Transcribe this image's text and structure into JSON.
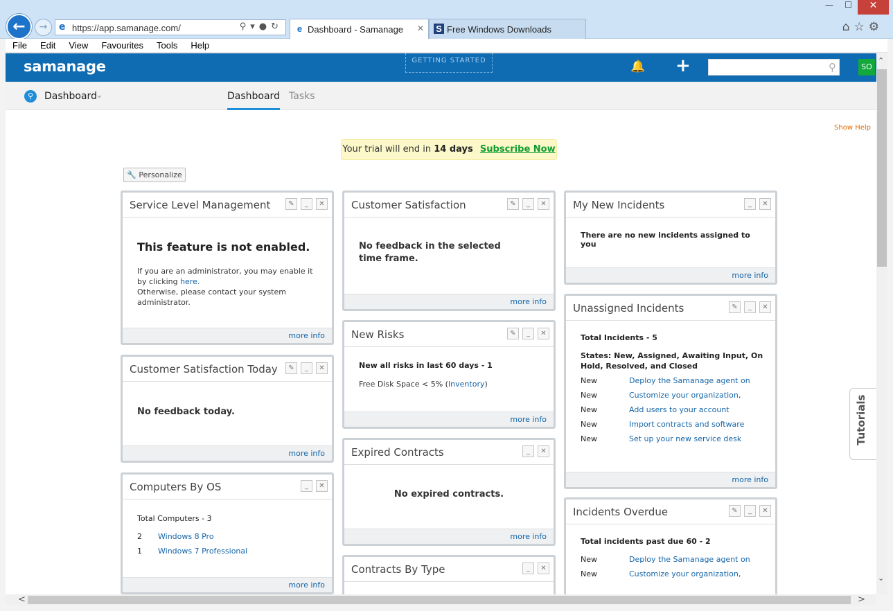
{
  "browser": {
    "url": "https://app.samanage.com/",
    "tabs": [
      {
        "label": "Dashboard - Samanage",
        "close": "✕"
      },
      {
        "label": "Free Windows Downloads"
      }
    ],
    "menu": [
      "File",
      "Edit",
      "View",
      "Favourites",
      "Tools",
      "Help"
    ],
    "window_controls": {
      "min": "—",
      "max": "☐",
      "close": "✕"
    }
  },
  "app": {
    "logo": "samanage",
    "getting_started": "GETTING STARTED",
    "avatar": "SO",
    "search_placeholder": "",
    "dashboard_title": "Dashboard",
    "subtabs": [
      "Dashboard",
      "Tasks"
    ],
    "show_help": "Show Help",
    "trial": {
      "prefix": "Your trial will end in",
      "days": "14 days",
      "cta": "Subscribe Now"
    },
    "personalize": "Personalize",
    "tutorials": "Tutorials"
  },
  "widgets": {
    "slm": {
      "title": "Service Level Management",
      "heading": "This feature is not enabled.",
      "line1": "If you are an administrator, you may enable it by clicking",
      "here": "here.",
      "line2": "Otherwise, please contact your system administrator.",
      "more": "more info"
    },
    "cst": {
      "title": "Customer Satisfaction Today",
      "text": "No feedback today.",
      "more": "more info"
    },
    "cbo": {
      "title": "Computers By OS",
      "total": "Total Computers - 3",
      "rows": [
        {
          "count": "2",
          "name": "Windows 8 Pro"
        },
        {
          "count": "1",
          "name": "Windows 7 Professional"
        }
      ],
      "more": "more info"
    },
    "cs": {
      "title": "Customer Satisfaction",
      "text": "No feedback in the selected time frame.",
      "more": "more info"
    },
    "nr": {
      "title": "New Risks",
      "total": "New all risks in last 60 days - 1",
      "item_prefix": "Free Disk Space < 5% (",
      "item_link": "Inventory",
      "item_suffix": ")",
      "more": "more info"
    },
    "ec": {
      "title": "Expired Contracts",
      "text": "No expired contracts.",
      "more": "more info"
    },
    "cbt": {
      "title": "Contracts By Type"
    },
    "mni": {
      "title": "My New Incidents",
      "text": "There are no new incidents assigned to you",
      "more": "more info"
    },
    "ui": {
      "title": "Unassigned Incidents",
      "total": "Total Incidents - 5",
      "states": "States: New, Assigned, Awaiting Input, On Hold, Resolved, and Closed",
      "rows": [
        {
          "state": "New",
          "link": "Deploy the Samanage agent on"
        },
        {
          "state": "New",
          "link": "Customize your organization,"
        },
        {
          "state": "New",
          "link": "Add users to your account"
        },
        {
          "state": "New",
          "link": "Import contracts and software"
        },
        {
          "state": "New",
          "link": "Set up your new service desk"
        }
      ],
      "more": "more info"
    },
    "io": {
      "title": "Incidents Overdue",
      "total": "Total incidents past due 60 - 2",
      "rows": [
        {
          "state": "New",
          "link": "Deploy the Samanage agent on"
        },
        {
          "state": "New",
          "link": "Customize your organization,"
        }
      ]
    }
  }
}
